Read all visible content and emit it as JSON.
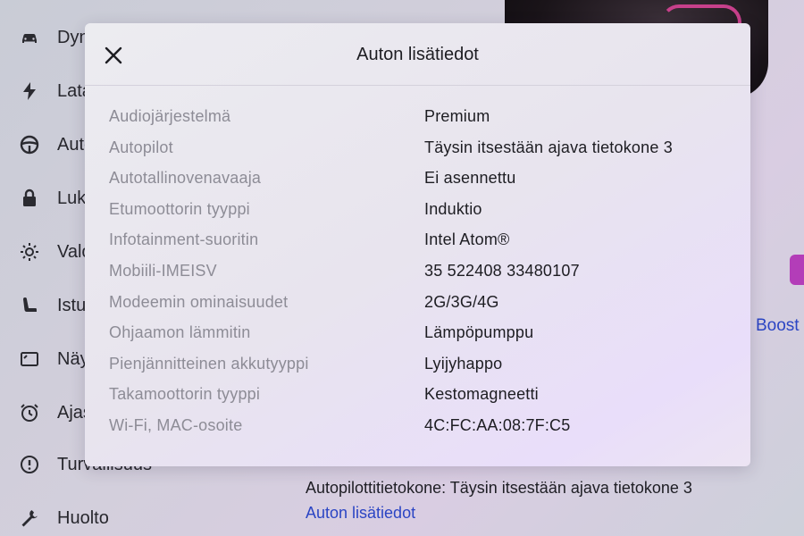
{
  "sidebar": {
    "items": [
      {
        "label": "Dynamiikka",
        "icon": "car-icon"
      },
      {
        "label": "Lataus",
        "icon": "lightning-icon"
      },
      {
        "label": "Autopilot",
        "icon": "steering-wheel-icon"
      },
      {
        "label": "Lukot",
        "icon": "lock-icon"
      },
      {
        "label": "Valot",
        "icon": "sun-icon"
      },
      {
        "label": "Istuimet",
        "icon": "seat-icon"
      },
      {
        "label": "Näyttö",
        "icon": "display-icon"
      },
      {
        "label": "Ajastukset",
        "icon": "alarm-clock-icon"
      },
      {
        "label": "Turvallisuus",
        "icon": "alert-circle-icon"
      },
      {
        "label": "Huolto",
        "icon": "wrench-icon"
      }
    ]
  },
  "background": {
    "boost_link": "Boost",
    "autopilot_computer": "Autopilottitietokone: Täysin itsestään ajava tietokone 3",
    "details_link": "Auton lisätiedot"
  },
  "modal": {
    "title": "Auton lisätiedot",
    "close_icon": "close-icon",
    "specs": [
      {
        "label": "Audiojärjestelmä",
        "value": "Premium"
      },
      {
        "label": "Autopilot",
        "value": "Täysin itsestään ajava tietokone 3"
      },
      {
        "label": "Autotallinovenavaaja",
        "value": "Ei asennettu"
      },
      {
        "label": "Etumoottorin tyyppi",
        "value": "Induktio"
      },
      {
        "label": "Infotainment-suoritin",
        "value": "Intel Atom®"
      },
      {
        "label": "Mobiili-IMEISV",
        "value": "35 522408 33480107"
      },
      {
        "label": "Modeemin ominaisuudet",
        "value": "2G/3G/4G"
      },
      {
        "label": "Ohjaamon lämmitin",
        "value": "Lämpöpumppu"
      },
      {
        "label": "Pienjännitteinen akkutyyppi",
        "value": "Lyijyhappo"
      },
      {
        "label": "Takamoottorin tyyppi",
        "value": "Kestomagneetti"
      },
      {
        "label": "Wi-Fi, MAC-osoite",
        "value": "4C:FC:AA:08:7F:C5"
      }
    ]
  },
  "colors": {
    "accent_link": "#2b45c4",
    "label_gray": "#8d8c96",
    "text_dark": "#1d1d22"
  }
}
